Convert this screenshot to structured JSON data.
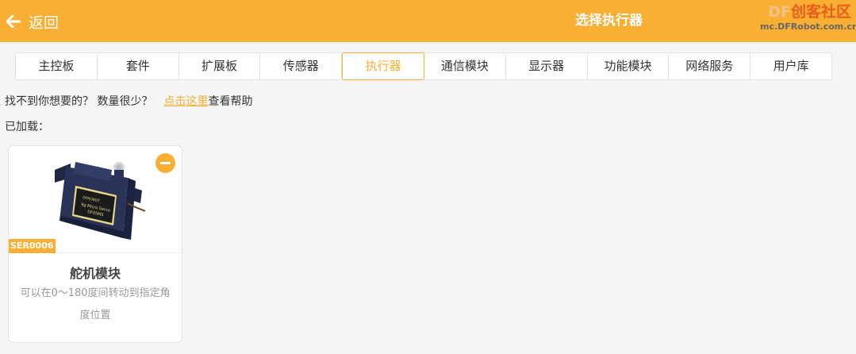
{
  "header": {
    "back_label": "返回",
    "title": "选择执行器",
    "watermark_brand_prefix": "DF",
    "watermark_brand_suffix": "创客社区",
    "watermark_url": "mc.DFRobot.com.cn",
    "accent_color": "#f9ae34"
  },
  "tabs": [
    {
      "label": "主控板",
      "active": false
    },
    {
      "label": "套件",
      "active": false
    },
    {
      "label": "扩展板",
      "active": false
    },
    {
      "label": "传感器",
      "active": false
    },
    {
      "label": "执行器",
      "active": true
    },
    {
      "label": "通信模块",
      "active": false
    },
    {
      "label": "显示器",
      "active": false
    },
    {
      "label": "功能模块",
      "active": false
    },
    {
      "label": "网络服务",
      "active": false
    },
    {
      "label": "用户库",
      "active": false
    }
  ],
  "help": {
    "text": "找不到你想要的？ 数量很少？",
    "link": "点击这里",
    "suffix": "查看帮助"
  },
  "loaded_label": "已加载：",
  "card": {
    "sku": "SER0006",
    "title": "舵机模块",
    "description": "可以在0～180度间转动到指定角度位置",
    "remove_icon": "minus-circle-icon",
    "image": "servo-motor-image",
    "servo_label_line1": "DFROBOT",
    "servo_label_line2": "9g Micro Servo",
    "servo_label_line3": "DF05MS"
  }
}
